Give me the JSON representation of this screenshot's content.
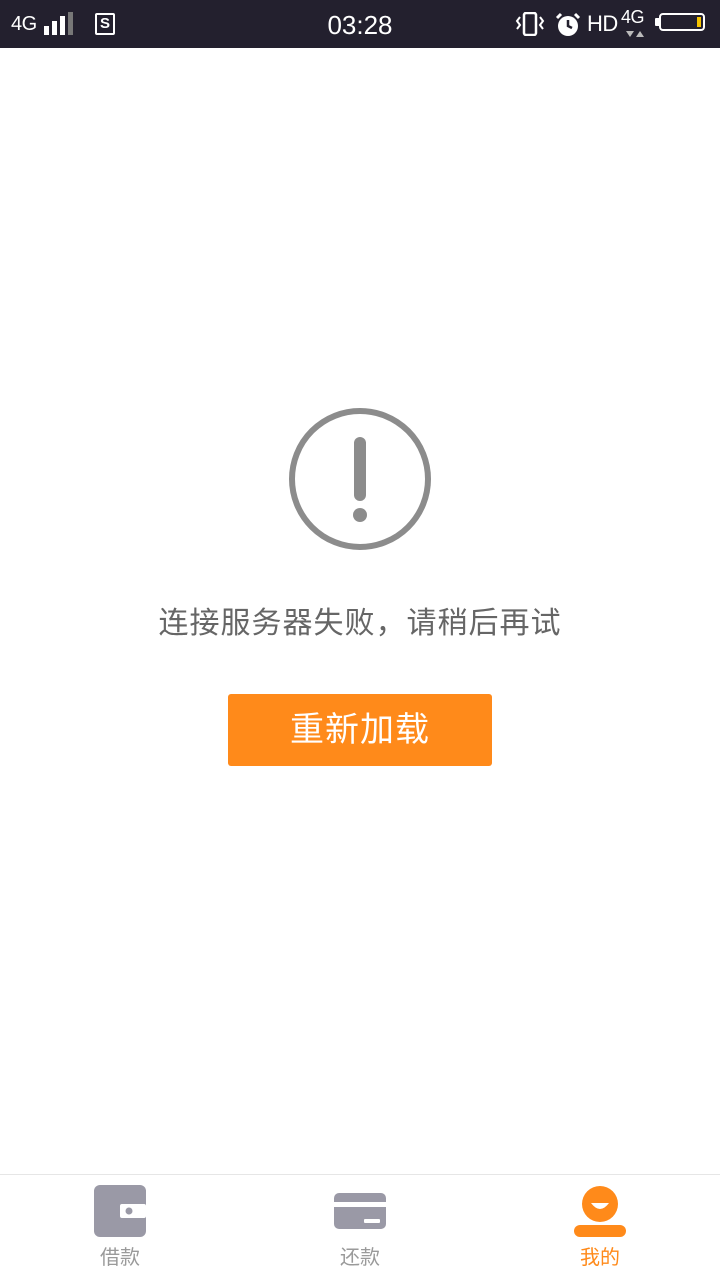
{
  "status_bar": {
    "network": "4G",
    "time": "03:28",
    "hd": "HD",
    "network2": "4G",
    "battery_level": 0.1,
    "battery_color": "#f6c400",
    "icons": [
      "signal-icon",
      "sim-s-icon",
      "vibrate-icon",
      "alarm-icon",
      "data-arrows-icon",
      "battery-icon"
    ]
  },
  "error": {
    "icon": "exclamation-circle-icon",
    "message": "连接服务器失败，请稍后再试",
    "reload_label": "重新加载"
  },
  "tabs": [
    {
      "label": "借款",
      "icon": "wallet-icon",
      "active": false
    },
    {
      "label": "还款",
      "icon": "card-icon",
      "active": false
    },
    {
      "label": "我的",
      "icon": "profile-icon",
      "active": true
    }
  ],
  "colors": {
    "accent": "#ff8a1a",
    "status_bar_bg": "#23202e",
    "inactive_icon": "#9a99a6",
    "error_icon": "#8c8c8c",
    "message_text": "#666666"
  }
}
